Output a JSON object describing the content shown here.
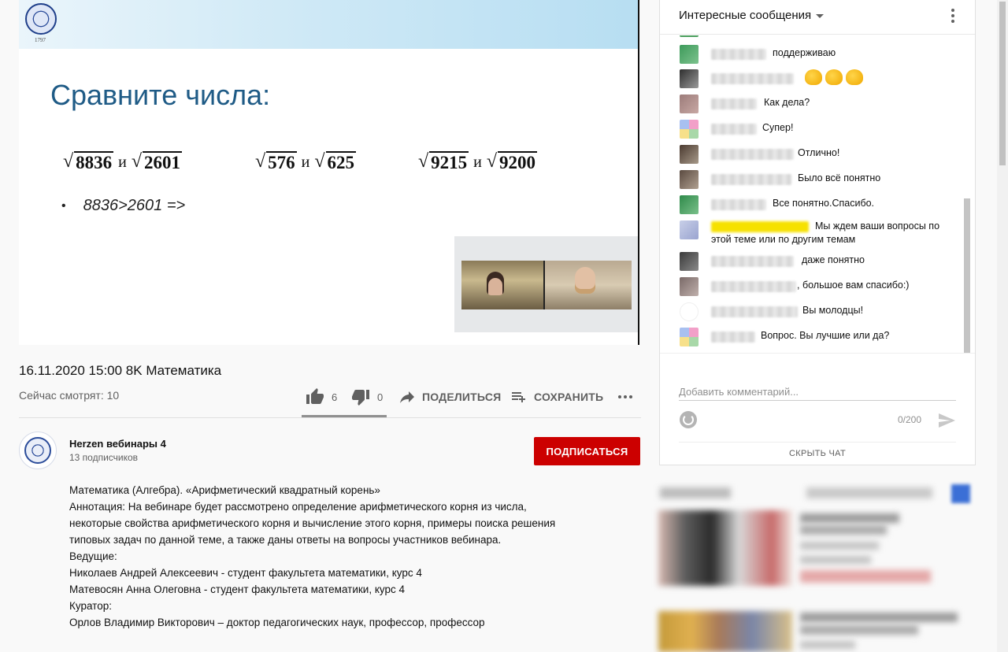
{
  "slide": {
    "logo_year": "1797",
    "title": "Сравните числа:",
    "pairs": [
      {
        "a": "8836",
        "and": "и",
        "b": "2601"
      },
      {
        "a": "576",
        "and": "и",
        "b": "625"
      },
      {
        "a": "9215",
        "and": "и",
        "b": "9200"
      }
    ],
    "radical": "√",
    "bullet_text": "8836>2601 =>"
  },
  "video": {
    "title": "16.11.2020 15:00 8K Математика",
    "viewers": "Сейчас смотрят: 10",
    "likes": "6",
    "dislikes": "0",
    "share_label": "ПОДЕЛИТЬСЯ",
    "save_label": "СОХРАНИТЬ",
    "like_ratio": 1.0
  },
  "channel": {
    "name": "Herzen вебинары 4",
    "subscribers": "13 подписчиков",
    "subscribe_label": "ПОДПИСАТЬСЯ"
  },
  "description": [
    "Математика (Алгебра). «Арифметический квадратный корень»",
    "Аннотация: На вебинаре будет рассмотрено определение арифметического корня из числа, некоторые свойства арифметического корня и вычисление этого корня, примеры поиска решения типовых задач по данной теме, а также даны ответы на вопросы участников вебинара.",
    "Ведущие:",
    "Николаев Андрей Алексеевич - студент факультета математики, курс 4",
    "Матевосян Анна Олеговна - студент факультета математики, курс 4",
    "Куратор:",
    "Орлов Владимир Викторович – доктор педагогических наук, профессор, профессор"
  ],
  "chat": {
    "title": "Интересные сообщения",
    "messages": [
      {
        "text": "поддерживаю",
        "avatar_color": "#4a9e5c"
      },
      {
        "text": "",
        "avatar_color": "#5a5a5a",
        "emoji": "clapping-hands-x3"
      },
      {
        "text": "Как дела?",
        "avatar_color": "#b08a88"
      },
      {
        "text": "Супер!",
        "avatar_color": "#e090c0"
      },
      {
        "text": "Отлично!",
        "avatar_color": "#6a5c50"
      },
      {
        "text": "Было всё понятно",
        "avatar_color": "#7a6a60"
      },
      {
        "text": "Все понятно.Спасибо.",
        "avatar_color": "#3d9a5a"
      },
      {
        "text": "Мы ждем ваши вопросы по этой теме или по другим темам",
        "avatar_color": "#a8b0d8",
        "highlighted": true
      },
      {
        "text": "даже понятно",
        "avatar_color": "#585858"
      },
      {
        "text": ", большое вам спасибо:)",
        "avatar_color": "#8a7a78"
      },
      {
        "text": "Вы молодцы!",
        "avatar_color": "#ffffff"
      },
      {
        "text": "Вопрос. Вы лучшие или да?",
        "avatar_color": "#e8a0c8"
      }
    ],
    "comment_placeholder": "Добавить комментарий...",
    "char_count": "0/200",
    "hide_label": "СКРЫТЬ ЧАТ"
  },
  "colors": {
    "subscribe": "#cc0000",
    "slide_title": "#1f5b86",
    "highlight_author": "#f6e100"
  }
}
